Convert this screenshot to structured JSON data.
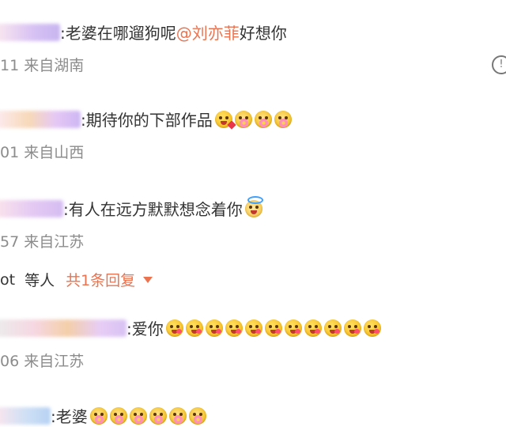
{
  "comments": [
    {
      "text": ":老婆在哪遛狗呢",
      "mention": "@刘亦菲",
      "text_after": " 好想你",
      "meta": "11 来自湖南",
      "emojis": []
    },
    {
      "text": ":期待你的下部作品",
      "meta": "01 来自山西",
      "emojis": [
        "kiss-emoji",
        "flower-emoji",
        "flower-emoji",
        "flower-emoji"
      ]
    },
    {
      "text": ":有人在远方默默想念着你",
      "meta": "57 来自江苏",
      "emojis": [
        "angel-emoji"
      ]
    },
    {
      "text": ":爱你",
      "meta": "06 来自江苏",
      "emojis": [
        "wink-emoji",
        "wink-emoji",
        "wink-emoji",
        "wink-emoji",
        "wink-emoji",
        "wink-emoji",
        "wink-emoji",
        "wink-emoji",
        "wink-emoji",
        "wink-emoji",
        "wink-emoji"
      ]
    },
    {
      "text": ":老婆",
      "emojis": [
        "flower-emoji",
        "flower-emoji",
        "flower-emoji",
        "flower-emoji",
        "flower-emoji",
        "flower-emoji"
      ]
    }
  ],
  "reply_bar": {
    "user_fragment": "ot",
    "others": "等人",
    "reply_count": "共1条回复",
    "caret_icon": "caret-down-icon"
  },
  "info_icon_glyph": "!",
  "colors": {
    "accent": "#eb7350",
    "meta_text": "#8c8c8c",
    "body_text": "#333333"
  }
}
